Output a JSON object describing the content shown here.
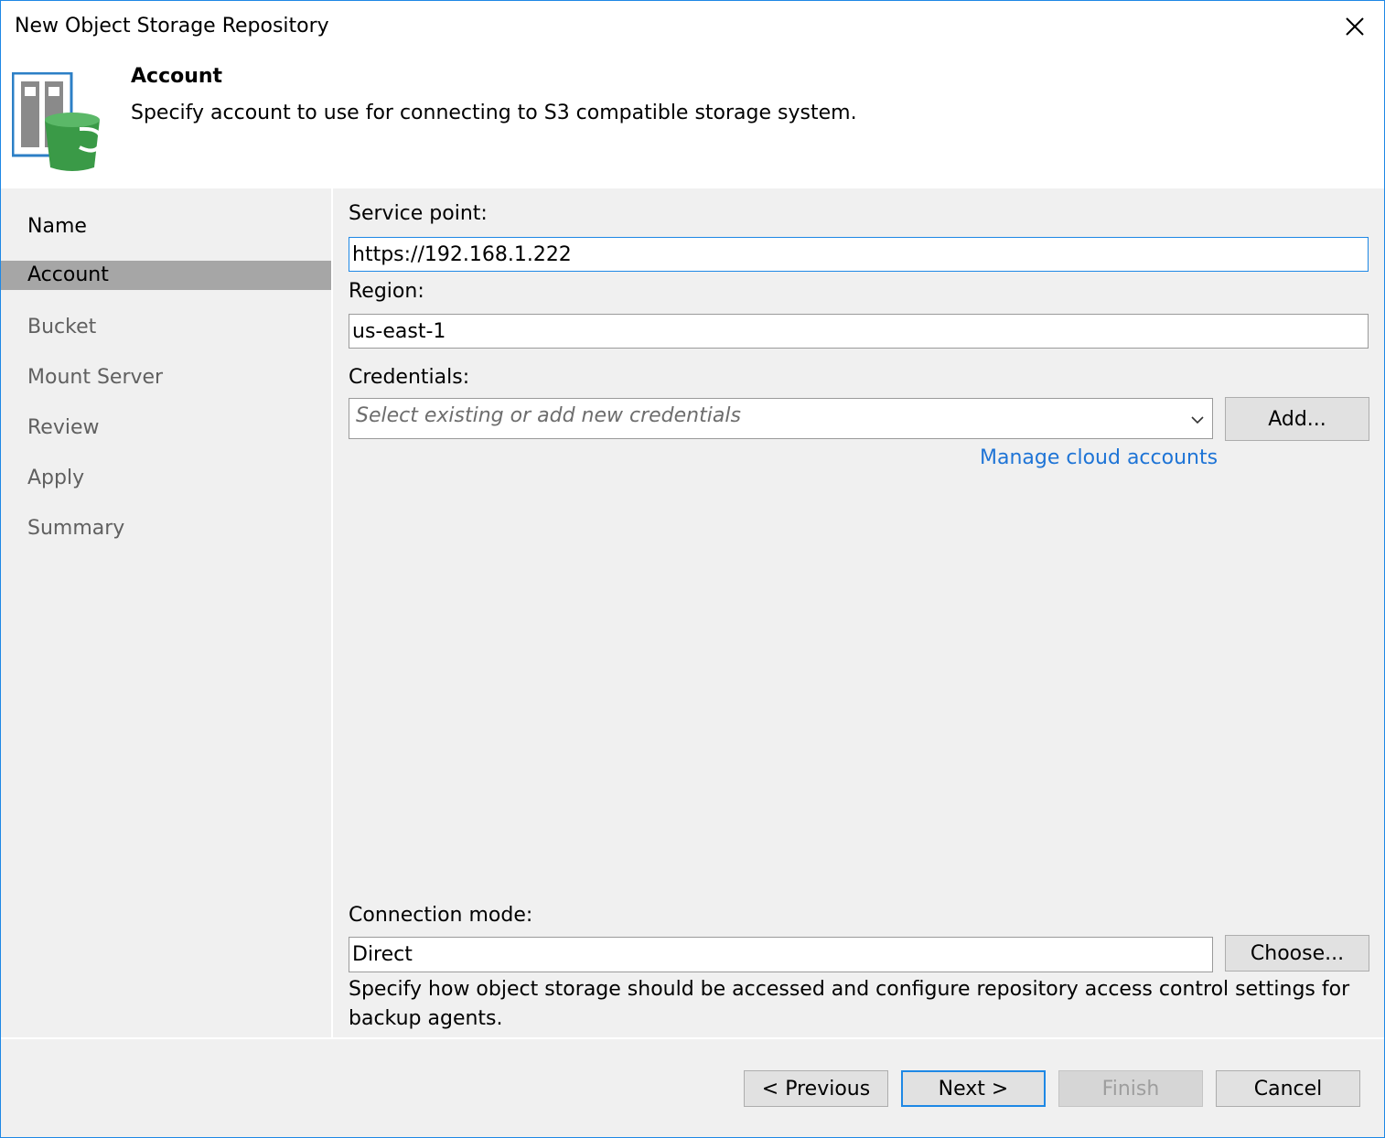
{
  "window": {
    "title": "New Object Storage Repository"
  },
  "header": {
    "title": "Account",
    "description": "Specify account to use for connecting to S3 compatible storage system."
  },
  "sidebar": {
    "items": [
      {
        "label": "Name"
      },
      {
        "label": "Account"
      },
      {
        "label": "Bucket"
      },
      {
        "label": "Mount Server"
      },
      {
        "label": "Review"
      },
      {
        "label": "Apply"
      },
      {
        "label": "Summary"
      }
    ],
    "active_index": 1
  },
  "form": {
    "service_point_label": "Service point:",
    "service_point_value": "https://192.168.1.222",
    "region_label": "Region:",
    "region_value": "us-east-1",
    "credentials_label": "Credentials:",
    "credentials_placeholder": "Select existing or add new credentials",
    "add_button": "Add...",
    "manage_link": "Manage cloud accounts",
    "connection_mode_label": "Connection mode:",
    "connection_mode_value": "Direct",
    "choose_button": "Choose...",
    "connection_help": "Specify how object storage should be accessed and configure repository access control settings for backup agents."
  },
  "footer": {
    "previous": "< Previous",
    "next": "Next >",
    "finish": "Finish",
    "cancel": "Cancel"
  },
  "icons": {
    "close": "close-icon",
    "repository": "object-storage-repository-icon",
    "dropdown": "chevron-down-icon"
  },
  "colors": {
    "accent": "#1e88e5",
    "link": "#1e74d6",
    "active_step": "#a6a6a6",
    "panel_bg": "#f0f0f0",
    "bucket_green": "#3a9a47"
  }
}
